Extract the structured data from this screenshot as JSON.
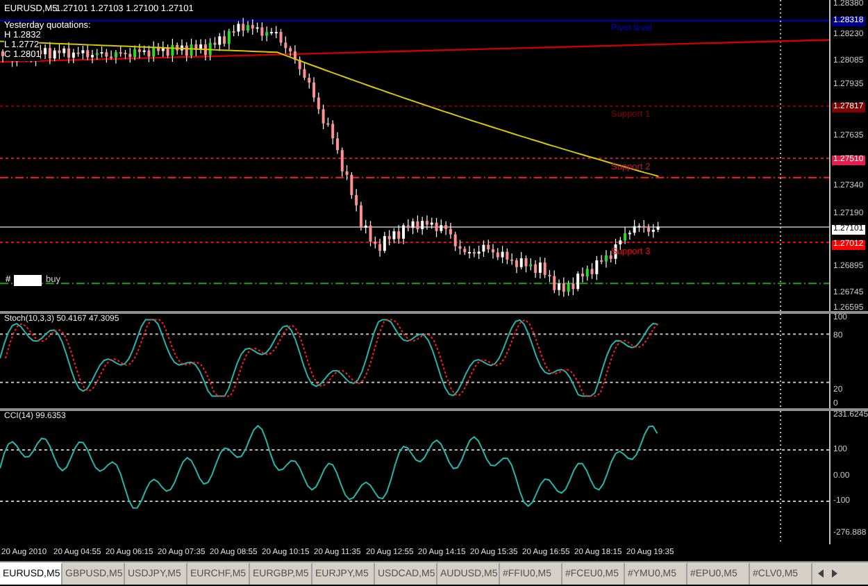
{
  "symbol_header": {
    "symbol": "EURUSD,M5",
    "quotes": "1.27101 1.27103 1.27100 1.27101"
  },
  "yesterday": {
    "title": "Yesterday quotations:",
    "lines": [
      "H 1.2832",
      "L 1.2772",
      "C 1.2801"
    ]
  },
  "level_labels": [
    {
      "label": "Pivot level",
      "color": "#0000cc"
    },
    {
      "label": "Support 1",
      "color": "#8b0000"
    },
    {
      "label": "Support 2",
      "color": "#c8143c"
    },
    {
      "label": "Support 3",
      "color": "#ff0000"
    }
  ],
  "order_widget": {
    "symbol": "#",
    "action": "buy"
  },
  "price_axis": {
    "ticks": [
      "1.28380",
      "1.28230",
      "1.28085",
      "1.27935",
      "1.27635",
      "1.27340",
      "1.27190",
      "1.26895",
      "1.26745",
      "1.26595"
    ],
    "tags": [
      {
        "value": "1.28318",
        "color": "#00008b"
      },
      {
        "value": "1.27817",
        "color": "#800000"
      },
      {
        "value": "1.27510",
        "color": "#e0204a"
      },
      {
        "value": "1.27101",
        "color": "#ffffff"
      },
      {
        "value": "1.27012",
        "color": "#ff0000"
      }
    ]
  },
  "stoch": {
    "title": "Stoch(10,3,3) 50.4167 47.3095",
    "ticks": [
      "100",
      "80",
      "20",
      "0"
    ]
  },
  "cci": {
    "title": "CCI(14) 99.6353",
    "ticks": [
      "231.6245",
      "100",
      "0.00",
      "-100",
      "-276.888"
    ]
  },
  "time_axis": [
    "20 Aug 2010",
    "20 Aug 04:55",
    "20 Aug 06:15",
    "20 Aug 07:35",
    "20 Aug 08:55",
    "20 Aug 10:15",
    "20 Aug 11:35",
    "20 Aug 12:55",
    "20 Aug 14:15",
    "20 Aug 15:35",
    "20 Aug 16:55",
    "20 Aug 18:15",
    "20 Aug 19:35"
  ],
  "tabs": [
    {
      "label": "EURUSD,M5",
      "selected": true
    },
    {
      "label": "GBPUSD,M5",
      "selected": false
    },
    {
      "label": "USDJPY,M5",
      "selected": false
    },
    {
      "label": "EURCHF,M5",
      "selected": false
    },
    {
      "label": "EURGBP,M5",
      "selected": false
    },
    {
      "label": "EURJPY,M5",
      "selected": false
    },
    {
      "label": "USDCAD,M5",
      "selected": false
    },
    {
      "label": "AUDUSD,M5",
      "selected": false
    },
    {
      "label": "#FFIU0,M5",
      "selected": false
    },
    {
      "label": "#FCEU0,M5",
      "selected": false
    },
    {
      "label": "#YMU0,M5",
      "selected": false
    },
    {
      "label": "#EPU0,M5",
      "selected": false
    },
    {
      "label": "#CLV0,M5",
      "selected": false
    }
  ]
}
